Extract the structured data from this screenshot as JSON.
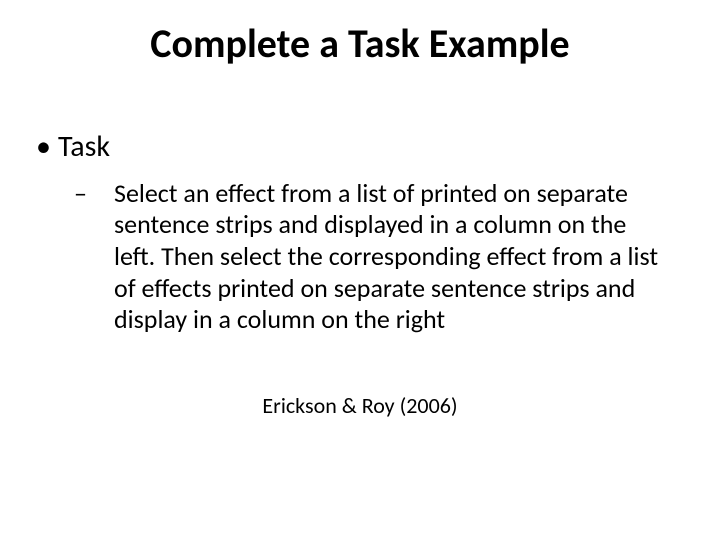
{
  "title": "Complete a Task Example",
  "bullets": {
    "level1": {
      "marker": "•",
      "text": "Task"
    },
    "level2": {
      "marker": "–",
      "text": "Select an effect from a list of printed on separate sentence strips and displayed in a column on the left.  Then select the corresponding effect from a list of effects printed on separate sentence strips and display in a column on the right"
    }
  },
  "citation": "Erickson & Roy (2006)"
}
